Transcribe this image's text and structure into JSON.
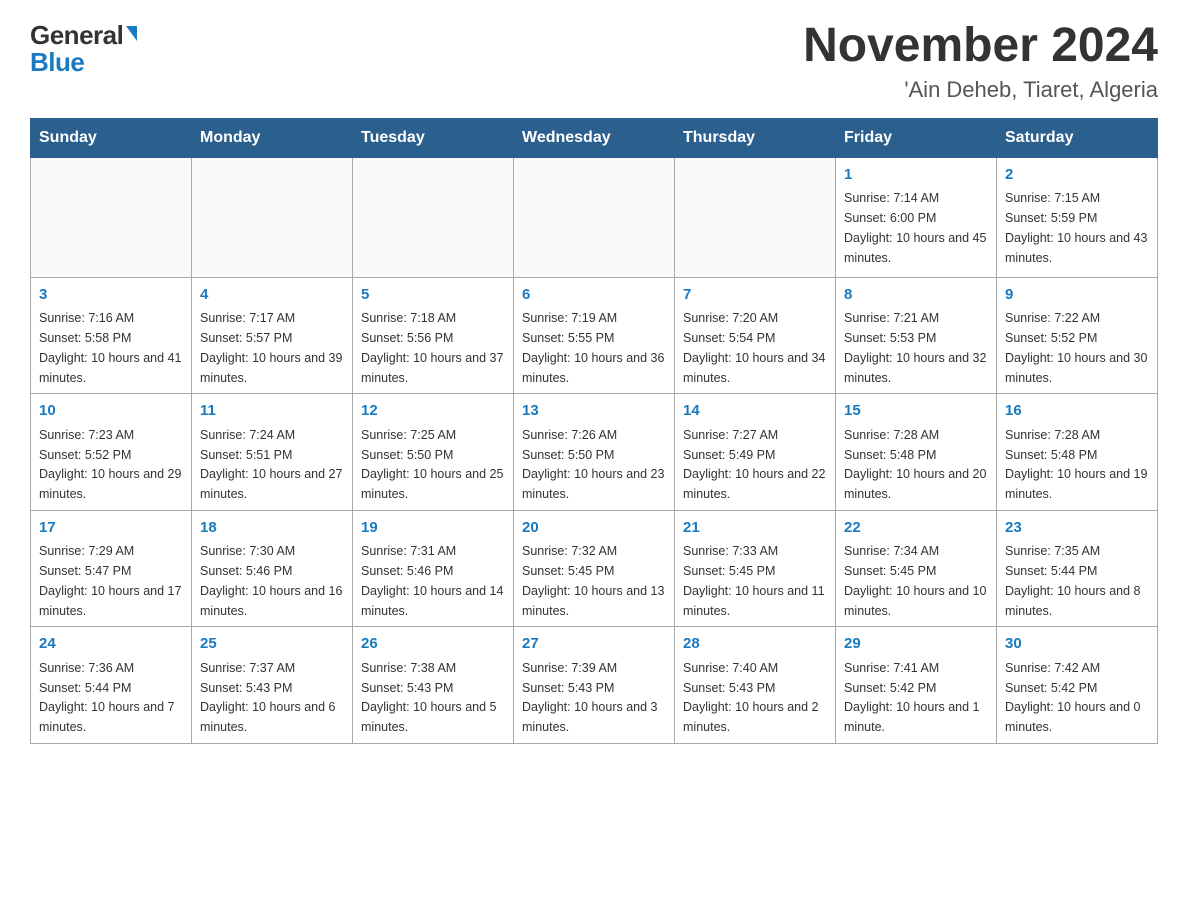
{
  "logo": {
    "general": "General",
    "blue": "Blue",
    "triangle": "▶"
  },
  "title": "November 2024",
  "subtitle": "'Ain Deheb, Tiaret, Algeria",
  "days_of_week": [
    "Sunday",
    "Monday",
    "Tuesday",
    "Wednesday",
    "Thursday",
    "Friday",
    "Saturday"
  ],
  "weeks": [
    {
      "cells": [
        {
          "day": "",
          "info": ""
        },
        {
          "day": "",
          "info": ""
        },
        {
          "day": "",
          "info": ""
        },
        {
          "day": "",
          "info": ""
        },
        {
          "day": "",
          "info": ""
        },
        {
          "day": "1",
          "info": "Sunrise: 7:14 AM\nSunset: 6:00 PM\nDaylight: 10 hours and 45 minutes."
        },
        {
          "day": "2",
          "info": "Sunrise: 7:15 AM\nSunset: 5:59 PM\nDaylight: 10 hours and 43 minutes."
        }
      ]
    },
    {
      "cells": [
        {
          "day": "3",
          "info": "Sunrise: 7:16 AM\nSunset: 5:58 PM\nDaylight: 10 hours and 41 minutes."
        },
        {
          "day": "4",
          "info": "Sunrise: 7:17 AM\nSunset: 5:57 PM\nDaylight: 10 hours and 39 minutes."
        },
        {
          "day": "5",
          "info": "Sunrise: 7:18 AM\nSunset: 5:56 PM\nDaylight: 10 hours and 37 minutes."
        },
        {
          "day": "6",
          "info": "Sunrise: 7:19 AM\nSunset: 5:55 PM\nDaylight: 10 hours and 36 minutes."
        },
        {
          "day": "7",
          "info": "Sunrise: 7:20 AM\nSunset: 5:54 PM\nDaylight: 10 hours and 34 minutes."
        },
        {
          "day": "8",
          "info": "Sunrise: 7:21 AM\nSunset: 5:53 PM\nDaylight: 10 hours and 32 minutes."
        },
        {
          "day": "9",
          "info": "Sunrise: 7:22 AM\nSunset: 5:52 PM\nDaylight: 10 hours and 30 minutes."
        }
      ]
    },
    {
      "cells": [
        {
          "day": "10",
          "info": "Sunrise: 7:23 AM\nSunset: 5:52 PM\nDaylight: 10 hours and 29 minutes."
        },
        {
          "day": "11",
          "info": "Sunrise: 7:24 AM\nSunset: 5:51 PM\nDaylight: 10 hours and 27 minutes."
        },
        {
          "day": "12",
          "info": "Sunrise: 7:25 AM\nSunset: 5:50 PM\nDaylight: 10 hours and 25 minutes."
        },
        {
          "day": "13",
          "info": "Sunrise: 7:26 AM\nSunset: 5:50 PM\nDaylight: 10 hours and 23 minutes."
        },
        {
          "day": "14",
          "info": "Sunrise: 7:27 AM\nSunset: 5:49 PM\nDaylight: 10 hours and 22 minutes."
        },
        {
          "day": "15",
          "info": "Sunrise: 7:28 AM\nSunset: 5:48 PM\nDaylight: 10 hours and 20 minutes."
        },
        {
          "day": "16",
          "info": "Sunrise: 7:28 AM\nSunset: 5:48 PM\nDaylight: 10 hours and 19 minutes."
        }
      ]
    },
    {
      "cells": [
        {
          "day": "17",
          "info": "Sunrise: 7:29 AM\nSunset: 5:47 PM\nDaylight: 10 hours and 17 minutes."
        },
        {
          "day": "18",
          "info": "Sunrise: 7:30 AM\nSunset: 5:46 PM\nDaylight: 10 hours and 16 minutes."
        },
        {
          "day": "19",
          "info": "Sunrise: 7:31 AM\nSunset: 5:46 PM\nDaylight: 10 hours and 14 minutes."
        },
        {
          "day": "20",
          "info": "Sunrise: 7:32 AM\nSunset: 5:45 PM\nDaylight: 10 hours and 13 minutes."
        },
        {
          "day": "21",
          "info": "Sunrise: 7:33 AM\nSunset: 5:45 PM\nDaylight: 10 hours and 11 minutes."
        },
        {
          "day": "22",
          "info": "Sunrise: 7:34 AM\nSunset: 5:45 PM\nDaylight: 10 hours and 10 minutes."
        },
        {
          "day": "23",
          "info": "Sunrise: 7:35 AM\nSunset: 5:44 PM\nDaylight: 10 hours and 8 minutes."
        }
      ]
    },
    {
      "cells": [
        {
          "day": "24",
          "info": "Sunrise: 7:36 AM\nSunset: 5:44 PM\nDaylight: 10 hours and 7 minutes."
        },
        {
          "day": "25",
          "info": "Sunrise: 7:37 AM\nSunset: 5:43 PM\nDaylight: 10 hours and 6 minutes."
        },
        {
          "day": "26",
          "info": "Sunrise: 7:38 AM\nSunset: 5:43 PM\nDaylight: 10 hours and 5 minutes."
        },
        {
          "day": "27",
          "info": "Sunrise: 7:39 AM\nSunset: 5:43 PM\nDaylight: 10 hours and 3 minutes."
        },
        {
          "day": "28",
          "info": "Sunrise: 7:40 AM\nSunset: 5:43 PM\nDaylight: 10 hours and 2 minutes."
        },
        {
          "day": "29",
          "info": "Sunrise: 7:41 AM\nSunset: 5:42 PM\nDaylight: 10 hours and 1 minute."
        },
        {
          "day": "30",
          "info": "Sunrise: 7:42 AM\nSunset: 5:42 PM\nDaylight: 10 hours and 0 minutes."
        }
      ]
    }
  ]
}
